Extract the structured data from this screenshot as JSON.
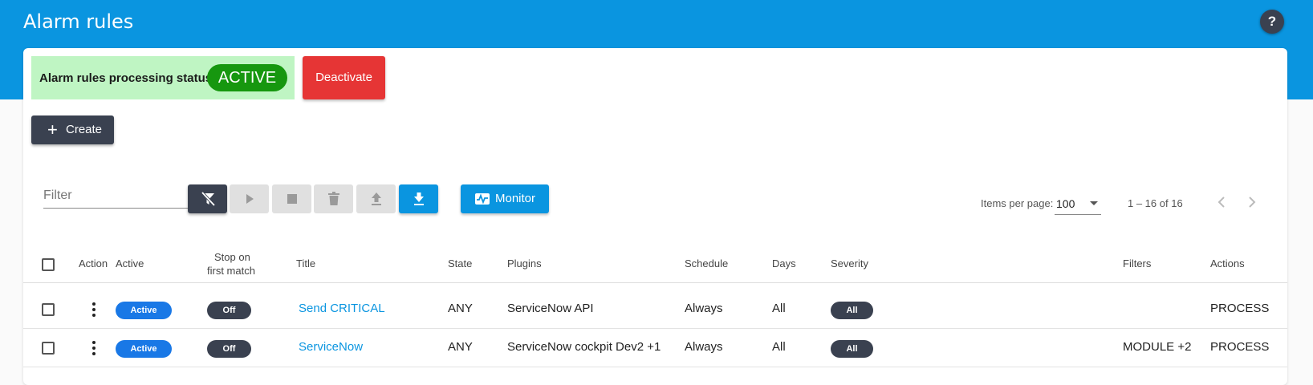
{
  "header": {
    "title": "Alarm rules",
    "help_label": "?"
  },
  "status": {
    "label": "Alarm rules processing status:",
    "value": "ACTIVE",
    "deactivate_label": "Deactivate"
  },
  "create_label": "Create",
  "filter": {
    "placeholder": "Filter",
    "value": ""
  },
  "toolbar": {
    "buttons": [
      {
        "icon": "clear-filter-icon",
        "enabled": true
      },
      {
        "icon": "play-icon",
        "enabled": false
      },
      {
        "icon": "stop-icon",
        "enabled": false
      },
      {
        "icon": "trash-icon",
        "enabled": false
      },
      {
        "icon": "upload-icon",
        "enabled": false
      },
      {
        "icon": "download-icon",
        "enabled": true
      }
    ],
    "monitor_label": "Monitor"
  },
  "pagination": {
    "items_per_page_label": "Items per page:",
    "items_per_page": "100",
    "range": "1 – 16 of 16"
  },
  "table": {
    "columns": {
      "action": "Action",
      "active": "Active",
      "stop_line1": "Stop on",
      "stop_line2": "first match",
      "title": "Title",
      "state": "State",
      "plugins": "Plugins",
      "schedule": "Schedule",
      "days": "Days",
      "severity": "Severity",
      "filters": "Filters",
      "actions": "Actions"
    },
    "rows": [
      {
        "active": "Active",
        "stop": "Off",
        "title": "Send CRITICAL",
        "state": "ANY",
        "plugins": "ServiceNow API",
        "schedule": "Always",
        "days": "All",
        "severity": "All",
        "filters": "",
        "actions": "PROCESS"
      },
      {
        "active": "Active",
        "stop": "Off",
        "title": "ServiceNow",
        "state": "ANY",
        "plugins": "ServiceNow cockpit Dev2 +1",
        "schedule": "Always",
        "days": "All",
        "severity": "All",
        "filters": "MODULE +2",
        "actions": "PROCESS"
      }
    ]
  },
  "colors": {
    "header_bg": "#0a95e0",
    "status_bg": "#bff5c3",
    "status_pill": "#16970f",
    "deactivate": "#e63535",
    "dark_button": "#3a4150",
    "active_chip": "#1978e6",
    "link": "#0a95e0"
  }
}
